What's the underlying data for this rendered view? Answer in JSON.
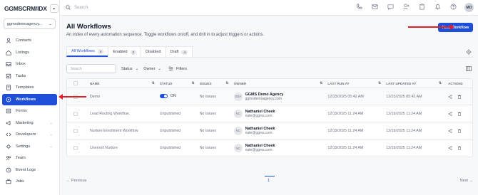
{
  "app": {
    "logo": "GGMSCRM/IDX"
  },
  "account": {
    "name": "ggmsdemoagency..."
  },
  "sidebar": {
    "items": [
      {
        "label": "Contacts",
        "icon": "contacts-icon"
      },
      {
        "label": "Listings",
        "icon": "listings-icon"
      },
      {
        "label": "Inbox",
        "icon": "inbox-icon"
      },
      {
        "label": "Tasks",
        "icon": "tasks-icon"
      },
      {
        "label": "Templates",
        "icon": "templates-icon"
      },
      {
        "label": "Workflows",
        "icon": "workflows-icon",
        "active": true
      },
      {
        "label": "Forms",
        "icon": "forms-icon"
      },
      {
        "label": "Marketing",
        "icon": "marketing-icon",
        "expandable": true
      },
      {
        "label": "Developers",
        "icon": "developers-icon",
        "expandable": true
      },
      {
        "label": "Settings",
        "icon": "settings-icon",
        "expandable": true
      },
      {
        "label": "Team",
        "icon": "team-icon"
      },
      {
        "label": "Event Logs",
        "icon": "event-logs-icon"
      },
      {
        "label": "Jobs",
        "icon": "jobs-icon"
      }
    ]
  },
  "topbar": {
    "search_placeholder": "Search",
    "avatar": "MO"
  },
  "page": {
    "title": "All Workflows",
    "subtitle": "An index of every automation sequence. Toggle workflows on/off, and drill in to adjust triggers or actions.",
    "new_button": "New Workflow"
  },
  "tabs": [
    {
      "label": "All Workflows",
      "count": "4",
      "active": true
    },
    {
      "label": "Enabled",
      "count": "2"
    },
    {
      "label": "Disabled",
      "count": ""
    },
    {
      "label": "Draft",
      "count": "4"
    }
  ],
  "filters": {
    "search_placeholder": "Search",
    "status": "Status",
    "owner": "Owner",
    "filters": "Filters"
  },
  "table": {
    "headers": [
      "Name",
      "Status",
      "Issues",
      "Owner",
      "Last Run At",
      "Last Updated At",
      "Actions"
    ],
    "rows": [
      {
        "name": "Demo",
        "status": "ON",
        "issues": "No issues",
        "owner_initials": "GDA",
        "owner_name": "GGMS Demo Agency",
        "owner_email": "ggmsdemoagency.com",
        "last_run": "12/23/2025 05:42 AM",
        "last_updated": "12/23/2025 05:42 AM"
      },
      {
        "name": "Lead Routing Workflow",
        "status": "Unpublished",
        "issues": "No issues",
        "owner_initials": "NC",
        "owner_name": "Nathaniel Cheek",
        "owner_email": "nate@ggms.com",
        "last_run": "12/19/2025 11:24 AM",
        "last_updated": "12/19/2025 11:24 AM"
      },
      {
        "name": "Nurture Enrollment Workflow",
        "status": "Unpublished",
        "issues": "No issues",
        "owner_initials": "NC",
        "owner_name": "Nathaniel Cheek",
        "owner_email": "nate@ggms.com",
        "last_run": "12/19/2025 11:24 AM",
        "last_updated": "12/19/2025 11:24 AM"
      },
      {
        "name": "Unenroll Nurture",
        "status": "Unpublished",
        "issues": "No issues",
        "owner_initials": "NC",
        "owner_name": "Nathaniel Cheek",
        "owner_email": "nate@ggms.com",
        "last_run": "12/19/2025 11:24 AM",
        "last_updated": "12/19/2025 11:24 AM"
      }
    ]
  },
  "pagination": {
    "previous": "Previous",
    "page": "1",
    "next": "Next"
  },
  "colors": {
    "accent": "#1f4ed8",
    "annotation": "#e11d2a"
  }
}
